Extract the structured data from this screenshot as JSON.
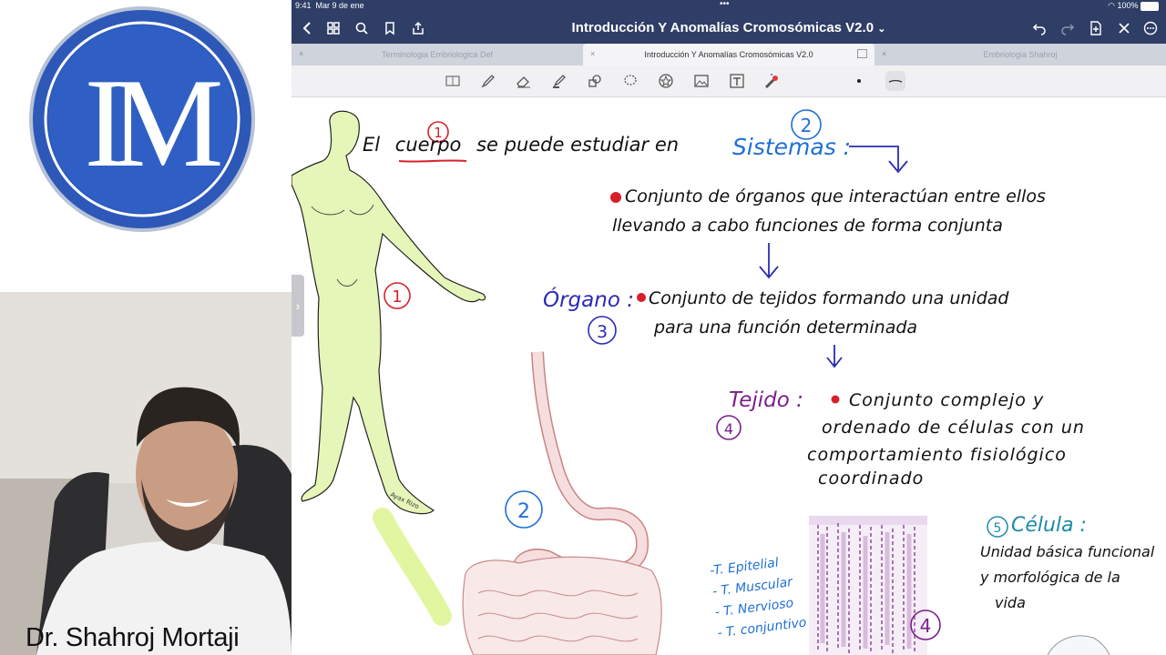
{
  "presenter": {
    "name": "Dr. Shahroj Mortaji"
  },
  "logo": {
    "text": "IM"
  },
  "status": {
    "time": "9:41",
    "date": "Mar 9 de ene",
    "battery": "100%"
  },
  "window": {
    "title": "Introducción Y Anomalías Cromosómicas  V2.0",
    "title_caret": "⌄",
    "more": "•••"
  },
  "tabs": [
    {
      "label": "Terminologia Embriologica Def"
    },
    {
      "label": "Introducción Y Anomalías Cromosómicas  V2.0"
    },
    {
      "label": "Embriologia Shahroj"
    }
  ],
  "tab_close": "×",
  "notes": {
    "intro_pre": "El",
    "intro_word": "cuerpo",
    "intro_post": "se puede estudiar en",
    "sistemas": "Sistemas :",
    "sistemas_def_1": "Conjunto de órganos que interactúan entre ellos",
    "sistemas_def_2": "llevando a cabo funciones de forma conjunta",
    "organo": "Órgano :",
    "organo_def_1": "Conjunto de tejidos formando una unidad",
    "organo_def_2": "para una función determinada",
    "tejido": "Tejido :",
    "tejido_def_1": "Conjunto complejo y",
    "tejido_def_2": "ordenado de células con un",
    "tejido_def_3": "comportamiento fisiológico",
    "tejido_def_4": "coordinado",
    "celula": "Célula :",
    "celula_def_1": "Unidad básica funcional",
    "celula_def_2": "y morfológica de la",
    "celula_def_3": "vida",
    "tissues": [
      "-T. Epitelial",
      "- T. Muscular",
      "- T. Nervioso",
      "- T. conjuntivo"
    ],
    "figure_signature": "Ayax Rizo",
    "n1": "1",
    "n2": "2",
    "n3": "3",
    "n4": "4",
    "n5": "5"
  },
  "colors": {
    "titlebar": "#2f3e66",
    "blue_ink": "#1f6fd6",
    "navy_ink": "#2b2bb5",
    "red_ink": "#d9202a",
    "purple_ink": "#7a1f8a",
    "teal_ink": "#1f8aa8",
    "body_fill": "#e6f5b8"
  }
}
